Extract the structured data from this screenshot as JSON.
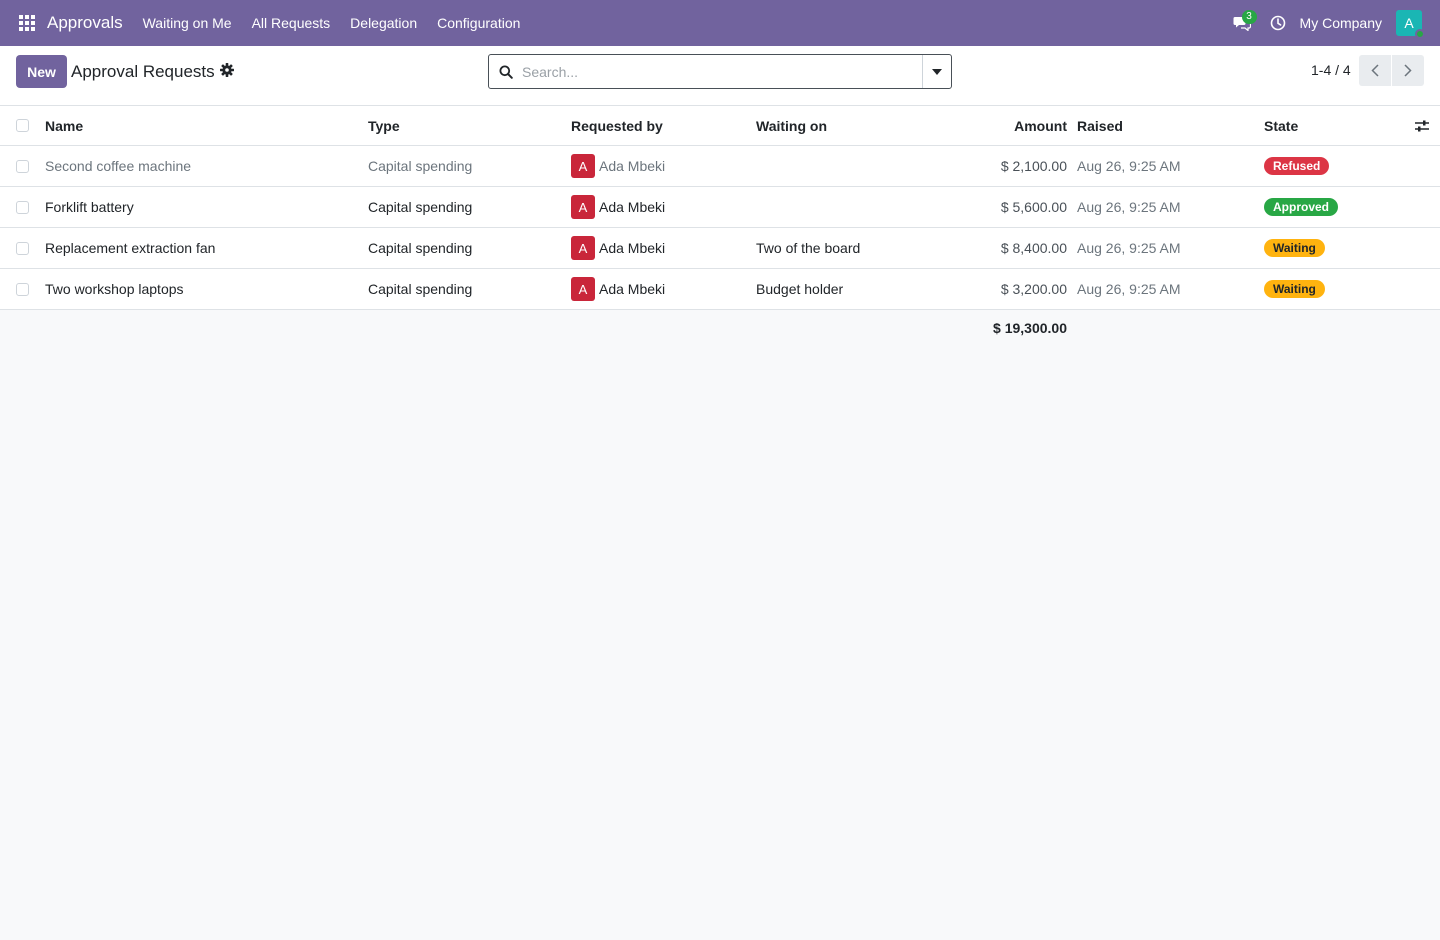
{
  "navbar": {
    "brand": "Approvals",
    "menu": [
      "Waiting on Me",
      "All Requests",
      "Delegation",
      "Configuration"
    ],
    "chat_count": "3",
    "company": "My Company",
    "avatar_letter": "A"
  },
  "control": {
    "new_label": "New",
    "title": "Approval Requests",
    "search_placeholder": "Search...",
    "pager": "1-4 / 4"
  },
  "columns": {
    "name": "Name",
    "type": "Type",
    "requested_by": "Requested by",
    "waiting_on": "Waiting on",
    "amount": "Amount",
    "raised": "Raised",
    "state": "State"
  },
  "rows": [
    {
      "name": "Second coffee machine",
      "type": "Capital spending",
      "initial": "A",
      "requester": "Ada Mbeki",
      "waiting_on": "",
      "amount": "$ 2,100.00",
      "raised": "Aug 26, 9:25 AM",
      "state": "Refused"
    },
    {
      "name": "Forklift battery",
      "type": "Capital spending",
      "initial": "A",
      "requester": "Ada Mbeki",
      "waiting_on": "",
      "amount": "$ 5,600.00",
      "raised": "Aug 26, 9:25 AM",
      "state": "Approved"
    },
    {
      "name": "Replacement extraction fan",
      "type": "Capital spending",
      "initial": "A",
      "requester": "Ada Mbeki",
      "waiting_on": "Two of the board",
      "amount": "$ 8,400.00",
      "raised": "Aug 26, 9:25 AM",
      "state": "Waiting"
    },
    {
      "name": "Two workshop laptops",
      "type": "Capital spending",
      "initial": "A",
      "requester": "Ada Mbeki",
      "waiting_on": "Budget holder",
      "amount": "$ 3,200.00",
      "raised": "Aug 26, 9:25 AM",
      "state": "Waiting"
    }
  ],
  "total_amount": "$ 19,300.00",
  "colors": {
    "brand": "#71639e",
    "refused": "#dc3545",
    "approved": "#28a745",
    "waiting": "#ffb30f"
  }
}
